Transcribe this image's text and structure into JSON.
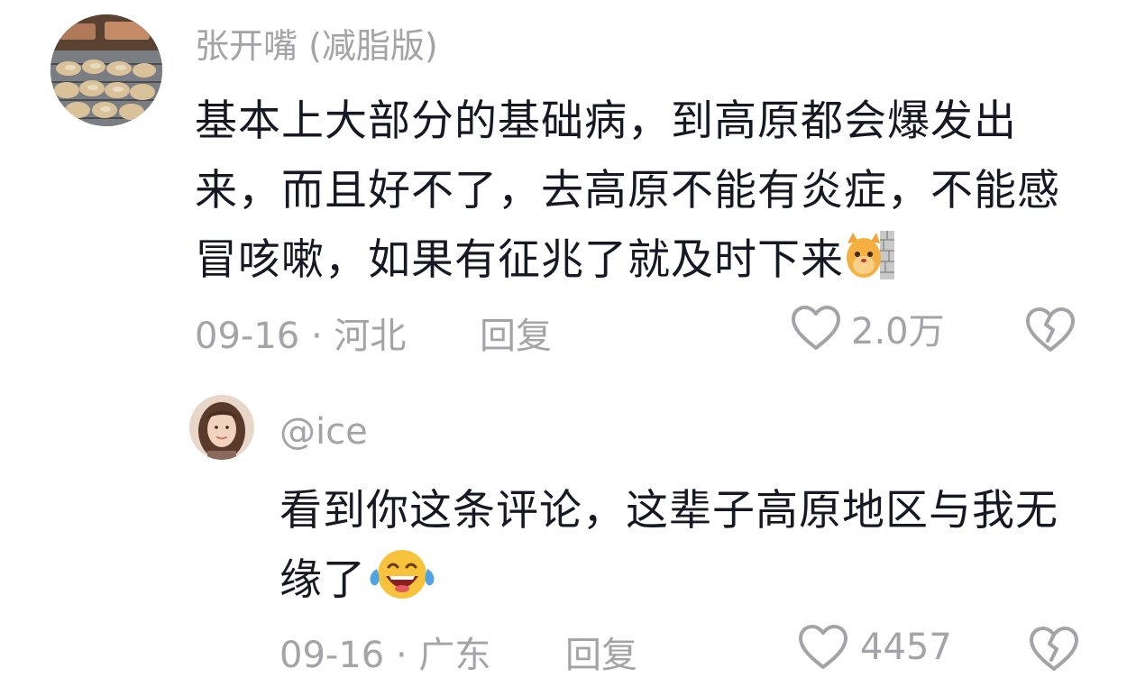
{
  "comments": [
    {
      "username": "张开嘴 (减脂版)",
      "content": "基本上大部分的基础病，到高原都会爆发出来，而且好不了，去高原不能有炎症，不能感冒咳嗽，如果有征兆了就及时下来",
      "emoji": "cat-peeking-wall-emoji",
      "date_location": "09-16 · 河北",
      "reply_label": "回复",
      "like_count": "2.0万",
      "avatar": "oysters-photo-avatar"
    },
    {
      "username": "@ice",
      "content": "看到你这条评论，这辈子高原地区与我无缘了",
      "emoji": "tears-of-joy-emoji",
      "date_location": "09-16 · 广东",
      "reply_label": "回复",
      "like_count": "4457",
      "avatar": "woman-portrait-avatar"
    }
  ],
  "colors": {
    "text_primary": "#161823",
    "text_secondary": "#a3a3a8",
    "background": "#ffffff"
  }
}
